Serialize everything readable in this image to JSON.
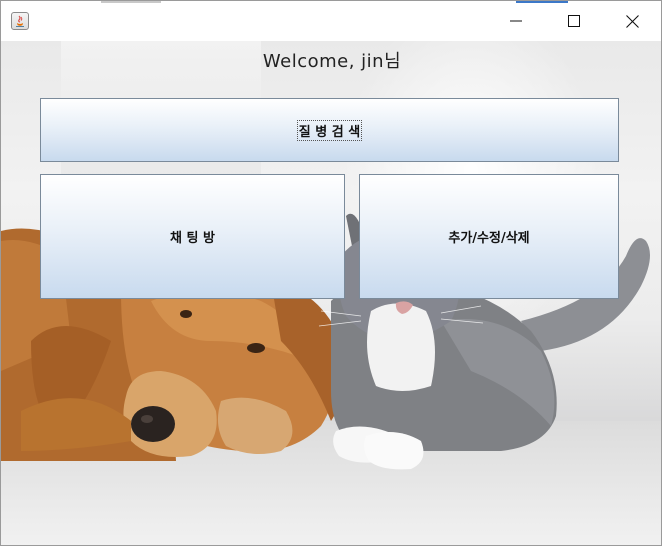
{
  "window": {
    "controls": {
      "minimize": "minimize-icon",
      "maximize": "maximize-icon",
      "close": "close-icon"
    },
    "app_icon": "java-icon"
  },
  "main": {
    "welcome": "Welcome, jin님",
    "buttons": {
      "search": "질 병 검 색",
      "chat": "채 팅 방",
      "edit": "추가/수정/삭제"
    },
    "background_image": "dog-and-cat-photo"
  },
  "colors": {
    "button_top": "#ffffff",
    "button_bottom": "#c8daee",
    "button_border": "#7a8a9a"
  }
}
